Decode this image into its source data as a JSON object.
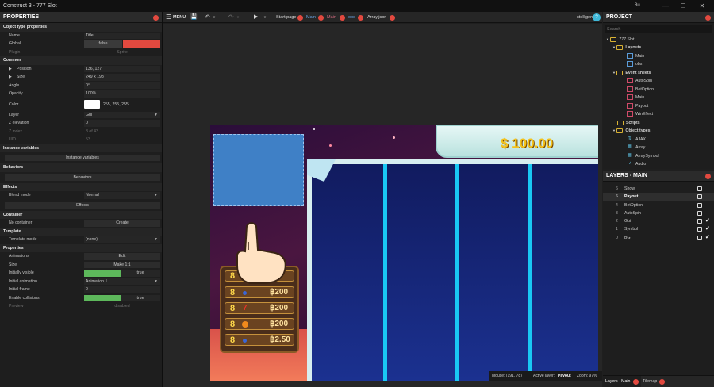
{
  "window": {
    "title": "Construct 3 - 777 Slot",
    "controls": [
      "―",
      "☐",
      "✕"
    ],
    "badge": "8u"
  },
  "toolbar": {
    "menu": "MENU",
    "start_page": "Start page",
    "main": "Main",
    "main2": "Main",
    "obs": "obs",
    "array_json": "Array.json",
    "user": "stelligen",
    "help": "?"
  },
  "properties": {
    "title": "PROPERTIES",
    "sections": {
      "object_type": "Object type properties",
      "common": "Common",
      "instance_vars": "Instance variables",
      "behaviors": "Behaviors",
      "effects": "Effects",
      "container": "Container",
      "template": "Template",
      "props": "Properties"
    },
    "name": {
      "label": "Name",
      "value": "Title"
    },
    "global": {
      "label": "Global",
      "value": "false"
    },
    "plugin": {
      "label": "Plugin",
      "value": "Sprite"
    },
    "position": {
      "label": "Position",
      "value": "136, 127"
    },
    "size": {
      "label": "Size",
      "value": "249 x 198"
    },
    "angle": {
      "label": "Angle",
      "value": "0°"
    },
    "opacity": {
      "label": "Opacity",
      "value": "100%"
    },
    "color": {
      "label": "Color",
      "value": "255, 255, 255",
      "swatch": "#ffffff"
    },
    "layer": {
      "label": "Layer",
      "value": "Gui"
    },
    "z_elevation": {
      "label": "Z elevation",
      "value": "0"
    },
    "z_index": {
      "label": "Z index",
      "value": "8 of 43"
    },
    "uid": {
      "label": "UID",
      "value": "53"
    },
    "instance_vars_btn": "Instance variables",
    "behaviors_btn": "Behaviors",
    "blend": {
      "label": "Blend mode",
      "value": "Normal"
    },
    "effects_btn": "Effects",
    "no_container": {
      "label": "No container",
      "value": "Create"
    },
    "template_mode": {
      "label": "Template mode",
      "value": "(none)"
    },
    "animations": {
      "label": "Animations",
      "value": "Edit"
    },
    "size2": {
      "label": "Size",
      "value": "Make 1:1"
    },
    "initially_visible": {
      "label": "Initially visible",
      "value": "true"
    },
    "initial_animation": {
      "label": "Initial animation",
      "value": "Animation 1"
    },
    "initial_frame": {
      "label": "Initial frame",
      "value": "0"
    },
    "enable_collisions": {
      "label": "Enable collisions",
      "value": "true"
    },
    "preview": {
      "label": "Preview",
      "value": "disabled"
    }
  },
  "game": {
    "balance": "$ 100.00",
    "paytable": [
      {
        "n": "8",
        "icon": "blue",
        "amount": "฿200"
      },
      {
        "n": "8",
        "icon": "seven",
        "amount": "฿200"
      },
      {
        "n": "8",
        "icon": "orange",
        "amount": "฿200"
      },
      {
        "n": "8",
        "icon": "blue",
        "amount": "฿2.50"
      }
    ],
    "paytable_top": "8"
  },
  "status": {
    "mouse": "Mouse: (191, 78)",
    "active_layer_label": "Active layer:",
    "active_layer": "Payout",
    "zoom": "Zoom: 97%"
  },
  "project": {
    "title": "PROJECT",
    "search_placeholder": "Search",
    "root": "777 Slot",
    "layouts": "Layouts",
    "layout_items": [
      "Main",
      "obs"
    ],
    "event_sheets": "Event sheets",
    "event_items": [
      "AutoSpin",
      "BetOption",
      "Main",
      "Payout",
      "WinEffect"
    ],
    "scripts": "Scripts",
    "object_types": "Object types",
    "object_items": [
      "AJAX",
      "Array",
      "ArraySymbol",
      "Audio"
    ]
  },
  "layers": {
    "title": "LAYERS - MAIN",
    "rows": [
      {
        "n": "6",
        "name": "Show",
        "check": ""
      },
      {
        "n": "5",
        "name": "Payout",
        "check": ""
      },
      {
        "n": "4",
        "name": "BetOption",
        "check": ""
      },
      {
        "n": "3",
        "name": "AutoSpin",
        "check": ""
      },
      {
        "n": "2",
        "name": "Gui",
        "check": "✔"
      },
      {
        "n": "1",
        "name": "Symbol",
        "check": "✔"
      },
      {
        "n": "0",
        "name": "BG",
        "check": "✔"
      }
    ]
  },
  "bottom_tabs": {
    "layers": "Layers - Main",
    "tilemap": "Tilemap"
  },
  "colors": {
    "accent_red": "#e2493f",
    "toggle_green": "#5db85b"
  }
}
